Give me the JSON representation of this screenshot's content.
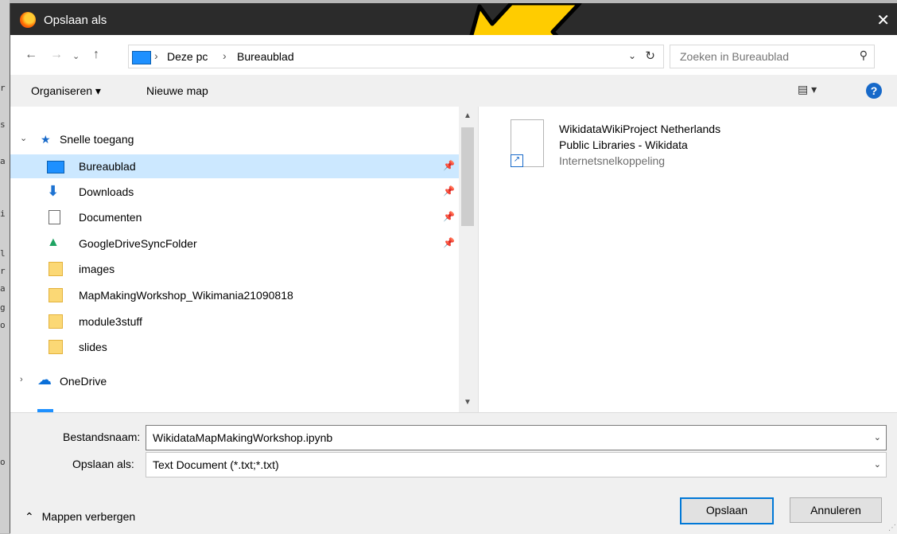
{
  "window": {
    "title": "Opslaan als"
  },
  "address": {
    "crumbs": [
      "Deze pc",
      "Bureaublad"
    ]
  },
  "search": {
    "placeholder": "Zoeken in Bureaublad"
  },
  "toolbar": {
    "organize": "Organiseren ▾",
    "new_folder": "Nieuwe map"
  },
  "nav": {
    "quick_access": "Snelle toegang",
    "items": [
      {
        "label": "Bureaublad",
        "pinned": true,
        "icon": "desktop-icon"
      },
      {
        "label": "Downloads",
        "pinned": true,
        "icon": "download-icon"
      },
      {
        "label": "Documenten",
        "pinned": true,
        "icon": "document-icon"
      },
      {
        "label": "GoogleDriveSyncFolder",
        "pinned": true,
        "icon": "google-drive-icon"
      },
      {
        "label": "images",
        "pinned": false,
        "icon": "folder-icon"
      },
      {
        "label": "MapMakingWorkshop_Wikimania21090818",
        "pinned": false,
        "icon": "folder-icon"
      },
      {
        "label": "module3stuff",
        "pinned": false,
        "icon": "folder-icon"
      },
      {
        "label": "slides",
        "pinned": false,
        "icon": "folder-icon"
      }
    ],
    "onedrive": "OneDrive"
  },
  "file": {
    "name_line1": "WikidataWikiProject Netherlands",
    "name_line2": "Public Libraries - Wikidata",
    "type": "Internetsnelkoppeling"
  },
  "form": {
    "filename_label": "Bestandsnaam:",
    "filename_value": "WikidataMapMakingWorkshop.ipynb",
    "savetype_label": "Opslaan als:",
    "savetype_value": "Text Document (*.txt;*.txt)"
  },
  "footer": {
    "hide_folders": "Mappen verbergen",
    "save": "Opslaan",
    "cancel": "Annuleren"
  },
  "colors": {
    "selection": "#cce8ff",
    "accent": "#0078d7",
    "titlebar": "#2b2b2b",
    "arrow_fill": "#ffcc00"
  }
}
